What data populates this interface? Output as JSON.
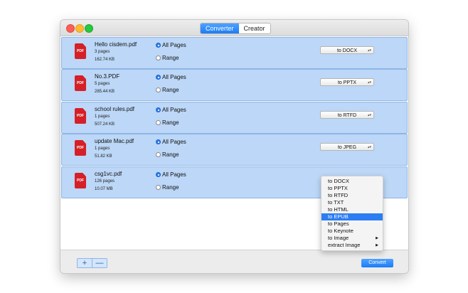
{
  "tabs": [
    {
      "label": "Converter",
      "active": true
    },
    {
      "label": "Creator",
      "active": false
    }
  ],
  "files": [
    {
      "name": "Hello cisdem.pdf",
      "pages": "3 pages",
      "size": "162.74 KB",
      "format": "to DOCX",
      "show_dropdown": true
    },
    {
      "name": "No.3.PDF",
      "pages": "5 pages",
      "size": "285.44 KB",
      "format": "to PPTX",
      "show_dropdown": true
    },
    {
      "name": "school rules.pdf",
      "pages": "1 pages",
      "size": "507.24 KB",
      "format": "to RTFD",
      "show_dropdown": true
    },
    {
      "name": "update Mac.pdf",
      "pages": "1 pages",
      "size": "51.82 KB",
      "format": "to JPEG",
      "show_dropdown": true
    },
    {
      "name": "csg1vc.pdf",
      "pages": "126 pages",
      "size": "10.07 MB",
      "format": "",
      "show_dropdown": false
    }
  ],
  "labels": {
    "pdf_icon": "PDF",
    "all_pages": "All Pages",
    "range": "Range"
  },
  "icons": {
    "file": "pdf-file-icon",
    "dropdown": "up-down-arrows-icon",
    "submenu": "triangle-right-icon"
  },
  "menu": {
    "items": [
      {
        "label": "to DOCX",
        "selected": false,
        "submenu": false
      },
      {
        "label": "to PPTX",
        "selected": false,
        "submenu": false
      },
      {
        "label": "to RTFD",
        "selected": false,
        "submenu": false
      },
      {
        "label": "to TXT",
        "selected": false,
        "submenu": false
      },
      {
        "label": "to HTML",
        "selected": false,
        "submenu": false
      },
      {
        "label": "to EPUB",
        "selected": true,
        "submenu": false
      },
      {
        "label": "to Pages",
        "selected": false,
        "submenu": false
      },
      {
        "label": "to Keynote",
        "selected": false,
        "submenu": false
      },
      {
        "label": "to Image",
        "selected": false,
        "submenu": true
      },
      {
        "label": "extract Image",
        "selected": false,
        "submenu": true
      }
    ]
  },
  "bottom": {
    "add_label": "+",
    "remove_label": "—",
    "convert_label": "Convert"
  },
  "colors": {
    "accent": "#2b7df3",
    "row_bg": "#bcd7f7",
    "pdf_red": "#d52027"
  }
}
